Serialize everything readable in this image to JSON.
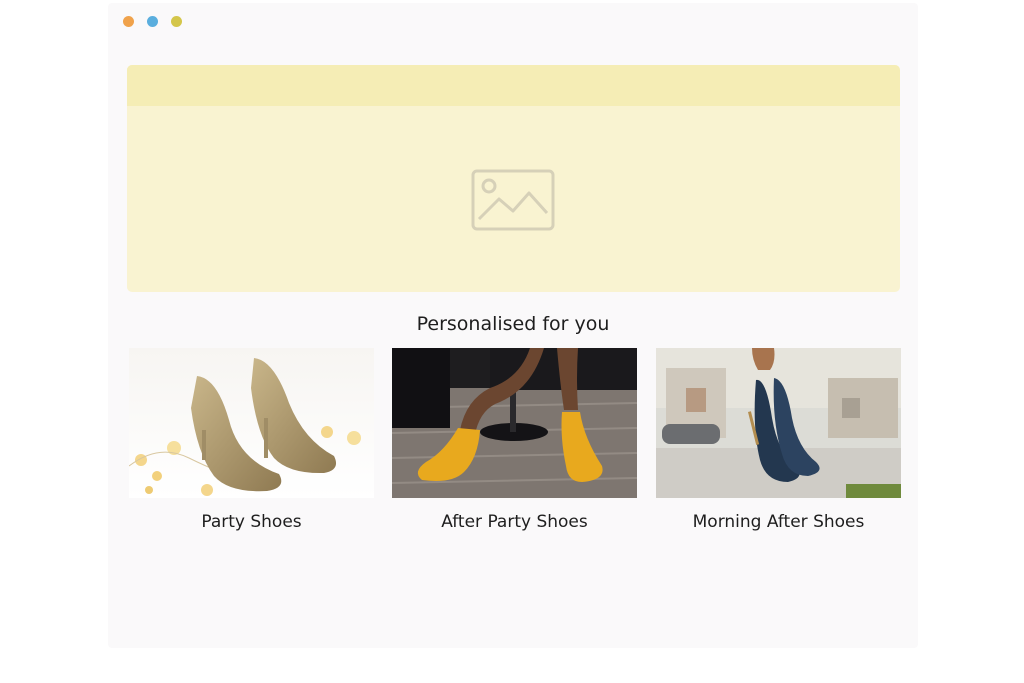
{
  "window": {
    "controls": [
      {
        "name": "close",
        "color": "#f0a24b"
      },
      {
        "name": "minimize",
        "color": "#5aaede"
      },
      {
        "name": "maximize",
        "color": "#d4c64a"
      }
    ]
  },
  "hero": {
    "icon": "image-placeholder-icon",
    "bar_color": "#f5edb5",
    "background_color": "#f9f3d1"
  },
  "section": {
    "title": "Personalised for you"
  },
  "products": [
    {
      "label": "Party Shoes",
      "image": "gold-glitter-heels"
    },
    {
      "label": "After Party Shoes",
      "image": "yellow-ankle-boots"
    },
    {
      "label": "Morning After Shoes",
      "image": "navy-heels-in-hand"
    }
  ]
}
